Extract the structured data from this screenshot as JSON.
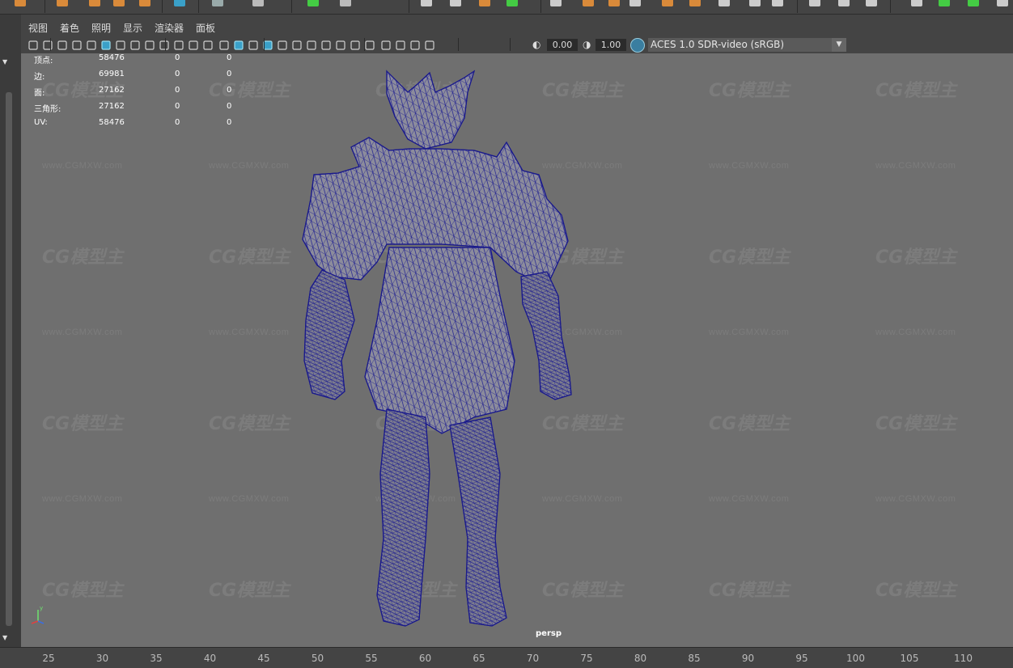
{
  "menu": [
    "视图",
    "着色",
    "照明",
    "显示",
    "渲染器",
    "面板"
  ],
  "viewport_toolbar": {
    "exposure_value": "0.00",
    "gamma_value": "1.00",
    "color_space": "ACES 1.0 SDR-video (sRGB)",
    "icons": [
      "camera-select-icon",
      "camera-attributes-icon",
      "bookmarks-icon",
      "image-plane-icon",
      "2d-pan-zoom-icon",
      "grease-pencil-icon",
      "grid-icon",
      "film-gate-icon",
      "resolution-gate-icon",
      "gate-mask-icon",
      "field-chart-icon",
      "safe-action-icon",
      "safe-title-icon",
      "wireframe-icon",
      "smooth-shade-icon",
      "use-default-material-icon",
      "wireframe-on-shaded-icon",
      "xray-icon",
      "use-all-lights-icon",
      "shadows-icon",
      "screen-space-ao-icon",
      "motion-blur-icon",
      "multisample-aa-icon",
      "depth-of-field-icon",
      "isolate-select-icon",
      "xray-active-icon",
      "xray-joints-icon",
      "backface-culling-icon"
    ]
  },
  "hud": {
    "rows": [
      {
        "label": "顶点:",
        "v1": "58476",
        "v2": "0",
        "v3": "0"
      },
      {
        "label": "边:",
        "v1": "69981",
        "v2": "0",
        "v3": "0"
      },
      {
        "label": "面:",
        "v1": "27162",
        "v2": "0",
        "v3": "0"
      },
      {
        "label": "三角形:",
        "v1": "27162",
        "v2": "0",
        "v3": "0"
      },
      {
        "label": "UV:",
        "v1": "58476",
        "v2": "0",
        "v3": "0"
      }
    ]
  },
  "camera_label": "persp",
  "axis": {
    "y": "y",
    "x": "x"
  },
  "watermark": {
    "logo": "CG模型主",
    "url": "www.CGMXW.com"
  },
  "timeline_ticks": [
    "25",
    "30",
    "35",
    "40",
    "45",
    "50",
    "55",
    "60",
    "65",
    "70",
    "75",
    "80",
    "85",
    "90",
    "95",
    "100",
    "105",
    "110"
  ],
  "colors": {
    "viewport_bg": "#6f6f6f",
    "wireframe": "#1a1a8c",
    "mesh_fill": "#8a8a9a",
    "panel_bg": "#444444"
  }
}
